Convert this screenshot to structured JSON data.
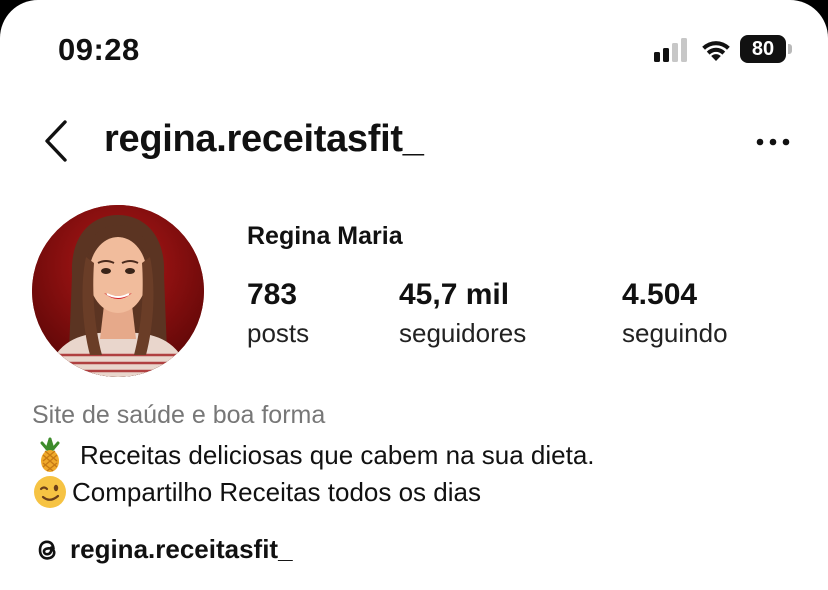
{
  "status_bar": {
    "time": "09:28",
    "battery_level": "80",
    "signal_bars_active": 2,
    "signal_bars_total": 4
  },
  "header": {
    "username": "regina.receitasfit_",
    "back_icon": "chevron-left-icon",
    "more_icon": "more-horizontal-icon"
  },
  "profile": {
    "display_name": "Regina Maria",
    "stats": [
      {
        "value": "783",
        "label": "posts"
      },
      {
        "value": "45,7 mil",
        "label": "seguidores"
      },
      {
        "value": "4.504",
        "label": "seguindo"
      }
    ]
  },
  "bio": {
    "category": "Site de saúde e boa forma",
    "line1": "Receitas deliciosas que cabem na sua dieta.",
    "line1_emoji": "pineapple-emoji",
    "line2": "Compartilho Receitas todos os dias",
    "line2_emoji": "winking-face-emoji"
  },
  "threads": {
    "handle": "regina.receitasfit_",
    "icon": "threads-icon"
  },
  "colors": {
    "text": "#111111",
    "muted": "#777777",
    "avatar_bg": "#7a1010"
  }
}
